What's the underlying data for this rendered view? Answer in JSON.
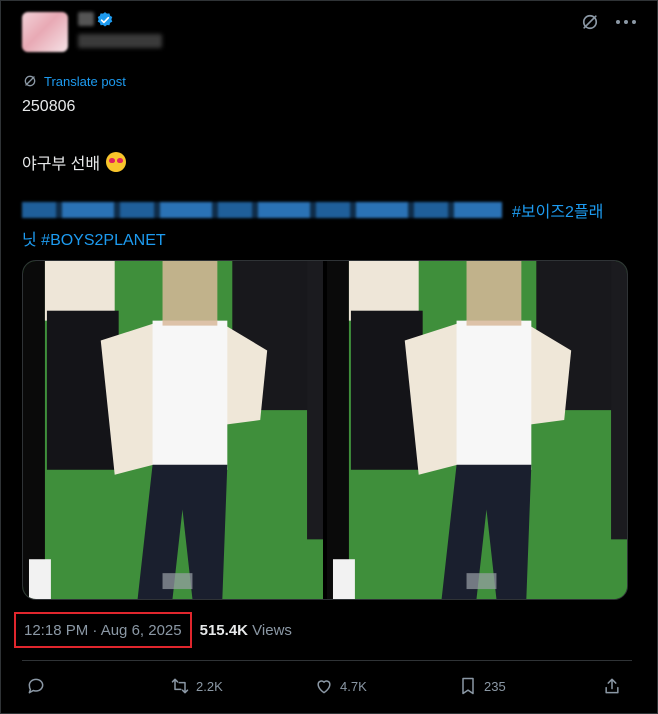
{
  "post": {
    "translate_label": "Translate post",
    "line1": "250806",
    "line2": "야구부 선배",
    "emoji": "heart-eyes-cat-emoji",
    "hashtag_a": "#보이즈2플래",
    "hashtag_b": "닛 #BOYS2PLANET"
  },
  "meta": {
    "timestamp": "12:18 PM · Aug 6, 2025",
    "views_count": "515.4K",
    "views_label": "Views"
  },
  "actions": {
    "reposts": "2.2K",
    "likes": "4.7K",
    "bookmarks": "235"
  },
  "colors": {
    "accent": "#1d9bf0",
    "highlight_box": "#e0262d",
    "muted": "#8b98a5"
  }
}
